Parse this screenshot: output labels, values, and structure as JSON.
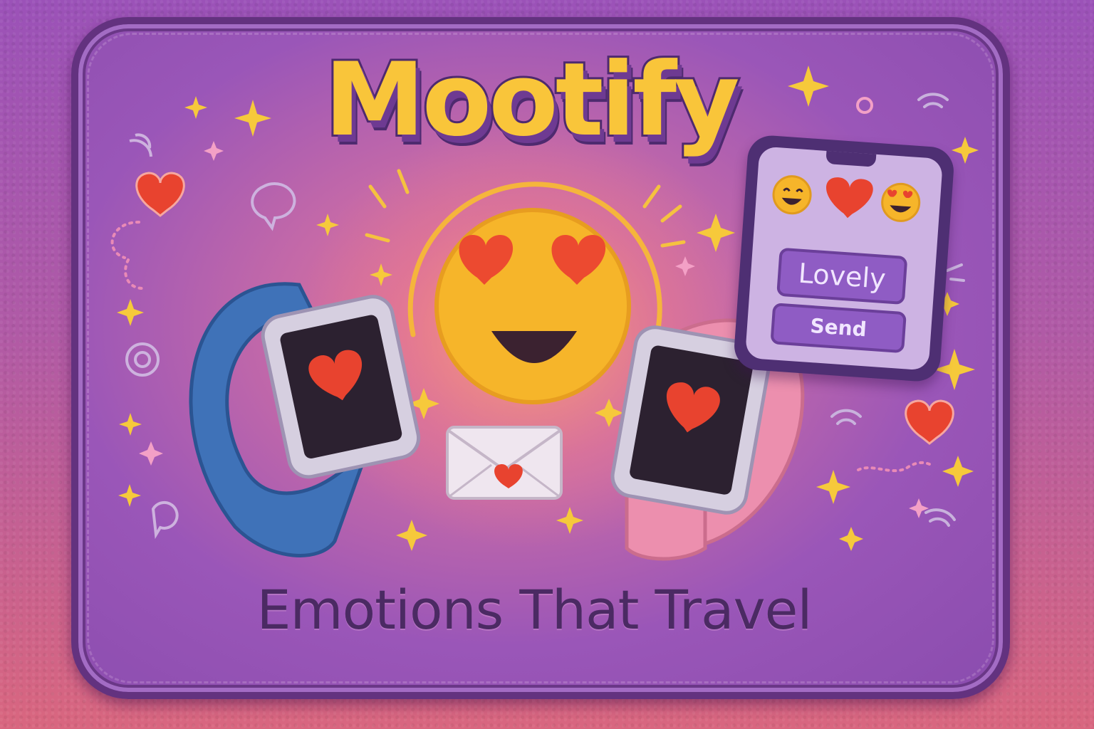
{
  "brand": {
    "title": "Mootify",
    "tagline": "Emotions That Travel"
  },
  "phone": {
    "reactions": [
      "smiling-face-icon",
      "heart-icon",
      "smiling-face-icon"
    ],
    "message_chip": "Lovely",
    "send_button": "Send"
  },
  "colors": {
    "background_top": "#9b52b8",
    "background_bottom": "#d9667f",
    "patch_border": "#63327f",
    "title_fill": "#f9c53a",
    "tagline": "#4b2a63",
    "heart": "#e8432f",
    "emoji_face": "#f6b52a",
    "band_left": "#3f72b8",
    "band_right": "#ec8fae"
  },
  "icons": [
    "heart-eyes-emoji-icon",
    "envelope-heart-icon",
    "smartwatch-blue-icon",
    "smartwatch-pink-icon",
    "sparkle-icon",
    "wifi-signal-icon",
    "chat-bubble-icon",
    "heart-icon"
  ]
}
